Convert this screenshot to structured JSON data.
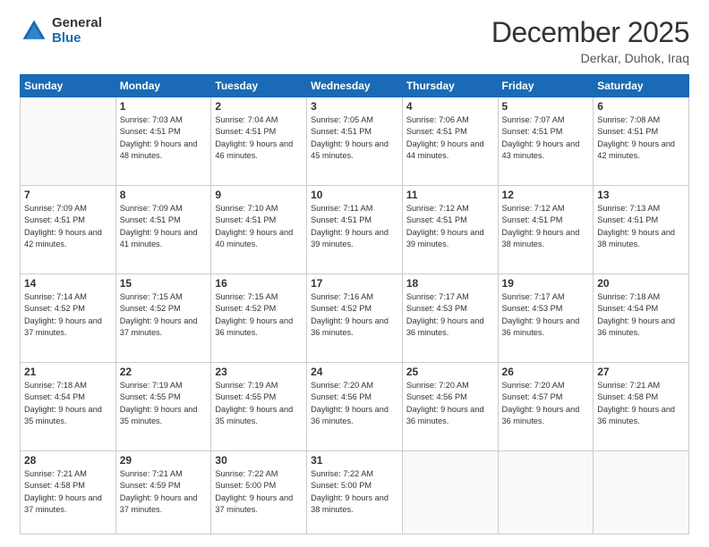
{
  "logo": {
    "general": "General",
    "blue": "Blue"
  },
  "header": {
    "month": "December 2025",
    "location": "Derkar, Duhok, Iraq"
  },
  "weekdays": [
    "Sunday",
    "Monday",
    "Tuesday",
    "Wednesday",
    "Thursday",
    "Friday",
    "Saturday"
  ],
  "weeks": [
    [
      {
        "day": null
      },
      {
        "day": 1,
        "sunrise": "7:03 AM",
        "sunset": "4:51 PM",
        "daylight": "9 hours and 48 minutes."
      },
      {
        "day": 2,
        "sunrise": "7:04 AM",
        "sunset": "4:51 PM",
        "daylight": "9 hours and 46 minutes."
      },
      {
        "day": 3,
        "sunrise": "7:05 AM",
        "sunset": "4:51 PM",
        "daylight": "9 hours and 45 minutes."
      },
      {
        "day": 4,
        "sunrise": "7:06 AM",
        "sunset": "4:51 PM",
        "daylight": "9 hours and 44 minutes."
      },
      {
        "day": 5,
        "sunrise": "7:07 AM",
        "sunset": "4:51 PM",
        "daylight": "9 hours and 43 minutes."
      },
      {
        "day": 6,
        "sunrise": "7:08 AM",
        "sunset": "4:51 PM",
        "daylight": "9 hours and 42 minutes."
      }
    ],
    [
      {
        "day": 7,
        "sunrise": "7:09 AM",
        "sunset": "4:51 PM",
        "daylight": "9 hours and 42 minutes."
      },
      {
        "day": 8,
        "sunrise": "7:09 AM",
        "sunset": "4:51 PM",
        "daylight": "9 hours and 41 minutes."
      },
      {
        "day": 9,
        "sunrise": "7:10 AM",
        "sunset": "4:51 PM",
        "daylight": "9 hours and 40 minutes."
      },
      {
        "day": 10,
        "sunrise": "7:11 AM",
        "sunset": "4:51 PM",
        "daylight": "9 hours and 39 minutes."
      },
      {
        "day": 11,
        "sunrise": "7:12 AM",
        "sunset": "4:51 PM",
        "daylight": "9 hours and 39 minutes."
      },
      {
        "day": 12,
        "sunrise": "7:12 AM",
        "sunset": "4:51 PM",
        "daylight": "9 hours and 38 minutes."
      },
      {
        "day": 13,
        "sunrise": "7:13 AM",
        "sunset": "4:51 PM",
        "daylight": "9 hours and 38 minutes."
      }
    ],
    [
      {
        "day": 14,
        "sunrise": "7:14 AM",
        "sunset": "4:52 PM",
        "daylight": "9 hours and 37 minutes."
      },
      {
        "day": 15,
        "sunrise": "7:15 AM",
        "sunset": "4:52 PM",
        "daylight": "9 hours and 37 minutes."
      },
      {
        "day": 16,
        "sunrise": "7:15 AM",
        "sunset": "4:52 PM",
        "daylight": "9 hours and 36 minutes."
      },
      {
        "day": 17,
        "sunrise": "7:16 AM",
        "sunset": "4:52 PM",
        "daylight": "9 hours and 36 minutes."
      },
      {
        "day": 18,
        "sunrise": "7:17 AM",
        "sunset": "4:53 PM",
        "daylight": "9 hours and 36 minutes."
      },
      {
        "day": 19,
        "sunrise": "7:17 AM",
        "sunset": "4:53 PM",
        "daylight": "9 hours and 36 minutes."
      },
      {
        "day": 20,
        "sunrise": "7:18 AM",
        "sunset": "4:54 PM",
        "daylight": "9 hours and 36 minutes."
      }
    ],
    [
      {
        "day": 21,
        "sunrise": "7:18 AM",
        "sunset": "4:54 PM",
        "daylight": "9 hours and 35 minutes."
      },
      {
        "day": 22,
        "sunrise": "7:19 AM",
        "sunset": "4:55 PM",
        "daylight": "9 hours and 35 minutes."
      },
      {
        "day": 23,
        "sunrise": "7:19 AM",
        "sunset": "4:55 PM",
        "daylight": "9 hours and 35 minutes."
      },
      {
        "day": 24,
        "sunrise": "7:20 AM",
        "sunset": "4:56 PM",
        "daylight": "9 hours and 36 minutes."
      },
      {
        "day": 25,
        "sunrise": "7:20 AM",
        "sunset": "4:56 PM",
        "daylight": "9 hours and 36 minutes."
      },
      {
        "day": 26,
        "sunrise": "7:20 AM",
        "sunset": "4:57 PM",
        "daylight": "9 hours and 36 minutes."
      },
      {
        "day": 27,
        "sunrise": "7:21 AM",
        "sunset": "4:58 PM",
        "daylight": "9 hours and 36 minutes."
      }
    ],
    [
      {
        "day": 28,
        "sunrise": "7:21 AM",
        "sunset": "4:58 PM",
        "daylight": "9 hours and 37 minutes."
      },
      {
        "day": 29,
        "sunrise": "7:21 AM",
        "sunset": "4:59 PM",
        "daylight": "9 hours and 37 minutes."
      },
      {
        "day": 30,
        "sunrise": "7:22 AM",
        "sunset": "5:00 PM",
        "daylight": "9 hours and 37 minutes."
      },
      {
        "day": 31,
        "sunrise": "7:22 AM",
        "sunset": "5:00 PM",
        "daylight": "9 hours and 38 minutes."
      },
      {
        "day": null
      },
      {
        "day": null
      },
      {
        "day": null
      }
    ]
  ],
  "labels": {
    "sunrise": "Sunrise:",
    "sunset": "Sunset:",
    "daylight": "Daylight:"
  }
}
